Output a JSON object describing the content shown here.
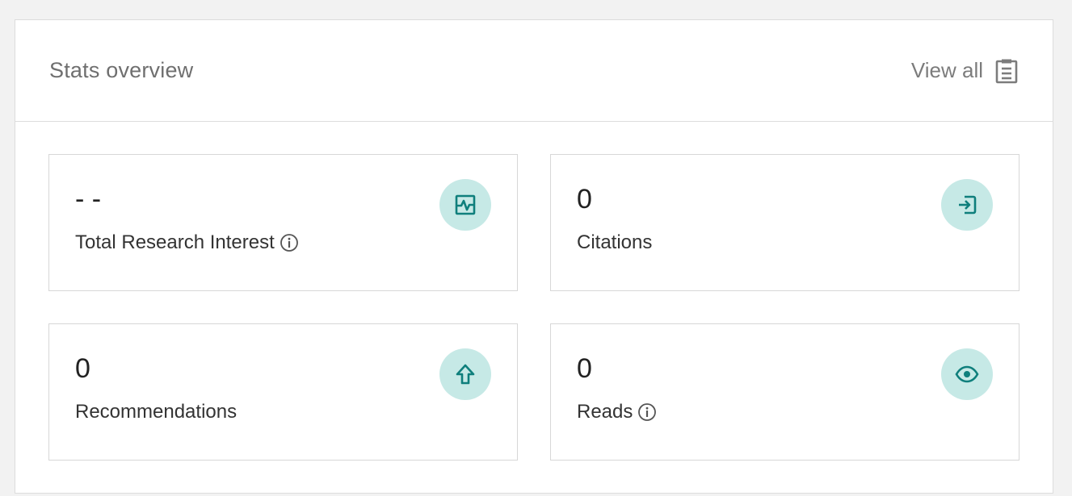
{
  "panel": {
    "title": "Stats overview",
    "view_all_label": "View all",
    "view_all_icon": "clipboard-list-icon"
  },
  "colors": {
    "accent": "#0f7f7c",
    "icon_bg": "#c6e9e6",
    "border": "#d7d7d7"
  },
  "cards": [
    {
      "value": "- -",
      "label": "Total Research Interest",
      "icon": "research-interest-icon",
      "info": true
    },
    {
      "value": "0",
      "label": "Citations",
      "icon": "citation-icon",
      "info": false
    },
    {
      "value": "0",
      "label": "Recommendations",
      "icon": "arrow-up-icon",
      "info": false
    },
    {
      "value": "0",
      "label": "Reads",
      "icon": "eye-icon",
      "info": true
    }
  ]
}
